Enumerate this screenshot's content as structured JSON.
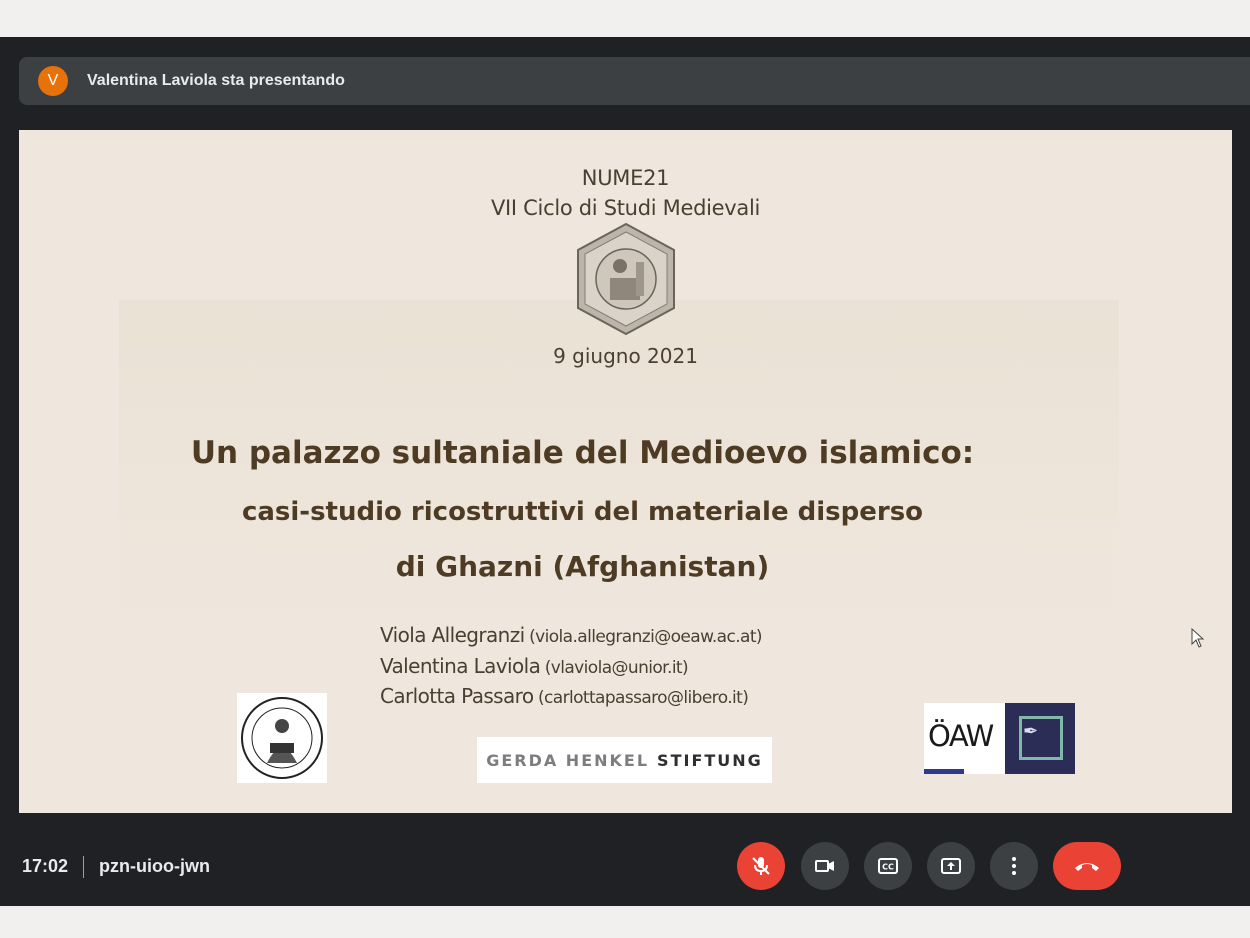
{
  "presenter": {
    "avatar_letter": "V",
    "text": "Valentina Laviola sta presentando",
    "avatar_color": "#e8710a"
  },
  "slide": {
    "event_line1": "NUME21",
    "event_line2": "VII Ciclo di Studi Medievali",
    "date": "9 giugno 2021",
    "title_line1": "Un palazzo sultaniale del Medioevo islamico:",
    "title_line2": "casi-studio ricostruttivi del materiale disperso",
    "title_line3": "di Ghazni (Afghanistan)",
    "authors": [
      {
        "name": "Viola Allegranzi",
        "email": "(viola.allegranzi@oeaw.ac.at)"
      },
      {
        "name": "Valentina Laviola",
        "email": "(vlaviola@unior.it)"
      },
      {
        "name": "Carlotta Passaro",
        "email": "(carlottapassaro@libero.it)"
      }
    ],
    "logos": {
      "ghs_part1": "GERDA HENKEL",
      "ghs_part2": "STIFTUNG",
      "oeaw": "ÖAW"
    }
  },
  "meeting": {
    "time": "17:02",
    "code": "pzn-uioo-jwn"
  },
  "controls": [
    "mic-off-icon",
    "camera-icon",
    "captions-icon",
    "present-icon",
    "more-vert-icon",
    "end-call-icon"
  ],
  "colors": {
    "meet_bg": "#202124",
    "control_bg": "#3c4043",
    "danger": "#ea4335",
    "slide_bg": "#efe7de",
    "title": "#4d3b24"
  }
}
